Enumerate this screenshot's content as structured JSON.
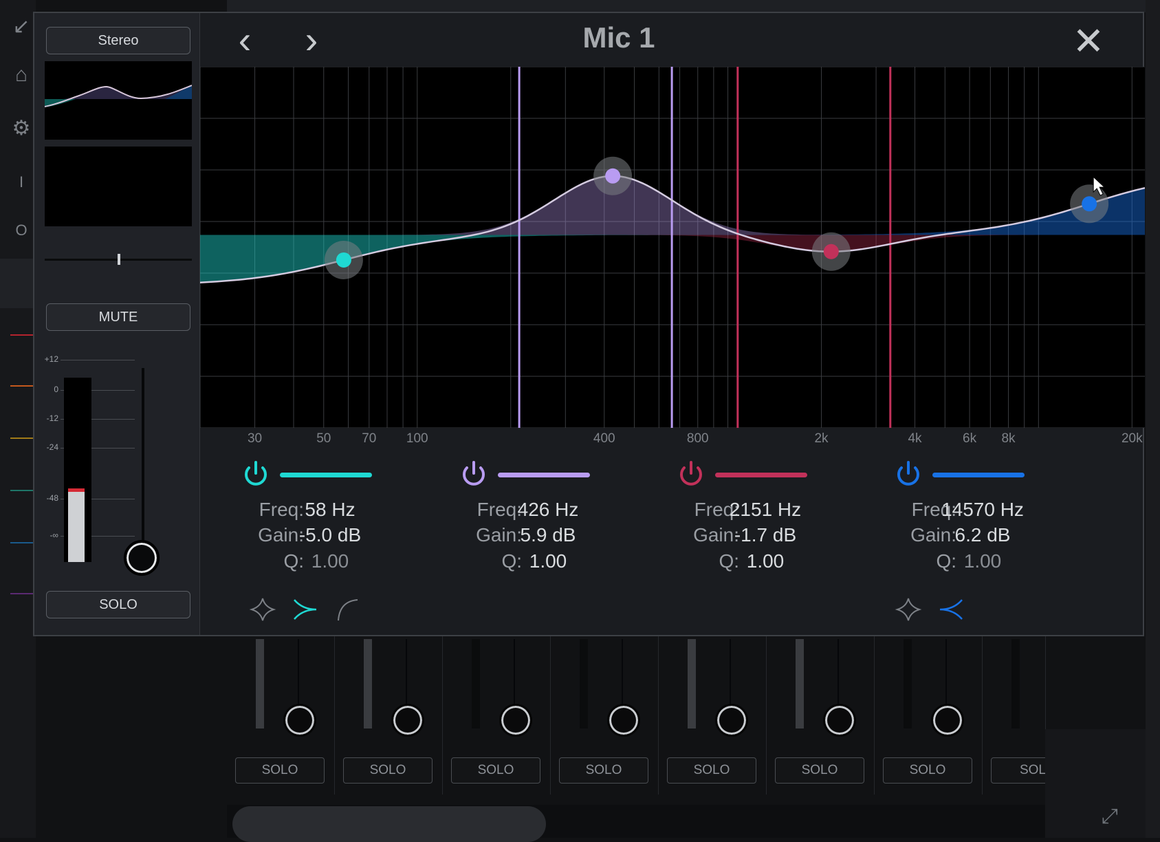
{
  "app": {
    "title": "Mic 1"
  },
  "strip": {
    "stereo_label": "Stereo",
    "mute_label": "MUTE",
    "solo_label": "SOLO",
    "scale_labels": [
      "+12",
      "0",
      "-12",
      "-24",
      "-48",
      "-∞"
    ],
    "meter_level": 0.38,
    "meter_peak": 0.36,
    "pan": 0.5
  },
  "freq_axis": [
    "30",
    "50",
    "70",
    "100",
    "400",
    "800",
    "2k",
    "4k",
    "6k",
    "8k",
    "20k"
  ],
  "bands": [
    {
      "color": "#1fd9d3",
      "freq_label": "Freq:",
      "gain_label": "Gain:",
      "q_label": "Q:",
      "freq": "58 Hz",
      "gain": "-5.0 dB",
      "q": "1.00",
      "q_dim": true,
      "shapes": [
        "bell-icon",
        "low-shelf-icon",
        "high-pass-icon"
      ]
    },
    {
      "color": "#b99cf2",
      "freq_label": "Freq:",
      "gain_label": "Gain:",
      "q_label": "Q:",
      "freq": "426 Hz",
      "gain": "5.9 dB",
      "q": "1.00",
      "q_dim": false,
      "shapes": []
    },
    {
      "color": "#c2315a",
      "freq_label": "Freq:",
      "gain_label": "Gain:",
      "q_label": "Q:",
      "freq": "2151 Hz",
      "gain": "-1.7 dB",
      "q": "1.00",
      "q_dim": false,
      "shapes": []
    },
    {
      "color": "#1872e6",
      "freq_label": "Freq:",
      "gain_label": "Gain:",
      "q_label": "Q:",
      "freq": "14570 Hz",
      "gain": "6.2 dB",
      "q": "1.00",
      "q_dim": true,
      "shapes": [
        "bell-icon",
        "high-shelf-icon"
      ]
    }
  ],
  "mixer": {
    "solo_labels": [
      "SOLO",
      "SOLO",
      "SOLO",
      "SOLO",
      "SOLO",
      "SOLO",
      "SOLO",
      "SOL"
    ]
  }
}
